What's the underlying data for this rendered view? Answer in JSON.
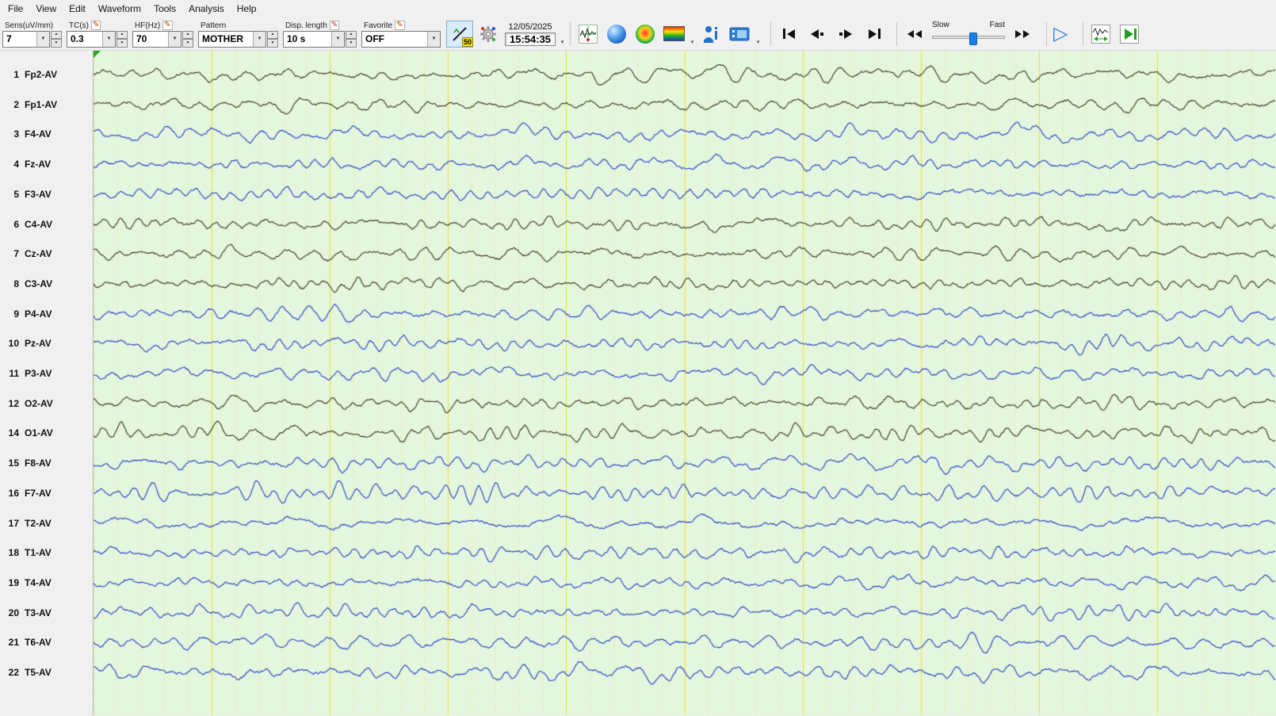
{
  "menu": {
    "items": [
      "File",
      "View",
      "Edit",
      "Waveform",
      "Tools",
      "Analysis",
      "Help"
    ]
  },
  "toolbar": {
    "sens": {
      "label": "Sens(uV/mm)",
      "value": "7"
    },
    "tc": {
      "label": "TC(s)",
      "value": "0.3"
    },
    "hf": {
      "label": "HF(Hz)",
      "value": "70"
    },
    "pattern": {
      "label": "Pattern",
      "value": "MOTHER"
    },
    "disp": {
      "label": "Disp. length",
      "value": "10 s"
    },
    "favorite": {
      "label": "Favorite",
      "value": "OFF"
    },
    "notch_badge": "50",
    "date": "12/05/2025",
    "time": "15:54:35",
    "speed": {
      "slow": "Slow",
      "fast": "Fast",
      "position": 0.55
    }
  },
  "palette": {
    "dark": "#38301a",
    "blue": "#2238c4",
    "grid_major": "rgba(236,222,40,0.95)",
    "grid_minor": "rgba(236,222,40,0.5)",
    "bg": "#e4f7de"
  },
  "display": {
    "seconds": 10,
    "row_spacing": 37.7,
    "first_baseline": 30
  },
  "channels": [
    {
      "num": "1",
      "label": "Fp2-AV",
      "color": "dark"
    },
    {
      "num": "2",
      "label": "Fp1-AV",
      "color": "dark"
    },
    {
      "num": "3",
      "label": "F4-AV",
      "color": "blue"
    },
    {
      "num": "4",
      "label": "Fz-AV",
      "color": "blue"
    },
    {
      "num": "5",
      "label": "F3-AV",
      "color": "blue"
    },
    {
      "num": "6",
      "label": "C4-AV",
      "color": "dark"
    },
    {
      "num": "7",
      "label": "Cz-AV",
      "color": "dark"
    },
    {
      "num": "8",
      "label": "C3-AV",
      "color": "dark"
    },
    {
      "num": "9",
      "label": "P4-AV",
      "color": "blue"
    },
    {
      "num": "10",
      "label": "Pz-AV",
      "color": "blue"
    },
    {
      "num": "11",
      "label": "P3-AV",
      "color": "blue"
    },
    {
      "num": "12",
      "label": "O2-AV",
      "color": "dark"
    },
    {
      "num": "14",
      "label": "O1-AV",
      "color": "dark"
    },
    {
      "num": "15",
      "label": "F8-AV",
      "color": "blue"
    },
    {
      "num": "16",
      "label": "F7-AV",
      "color": "blue"
    },
    {
      "num": "17",
      "label": "T2-AV",
      "color": "blue"
    },
    {
      "num": "18",
      "label": "T1-AV",
      "color": "blue"
    },
    {
      "num": "19",
      "label": "T4-AV",
      "color": "blue"
    },
    {
      "num": "20",
      "label": "T3-AV",
      "color": "blue"
    },
    {
      "num": "21",
      "label": "T6-AV",
      "color": "blue"
    },
    {
      "num": "22",
      "label": "T5-AV",
      "color": "blue"
    }
  ]
}
